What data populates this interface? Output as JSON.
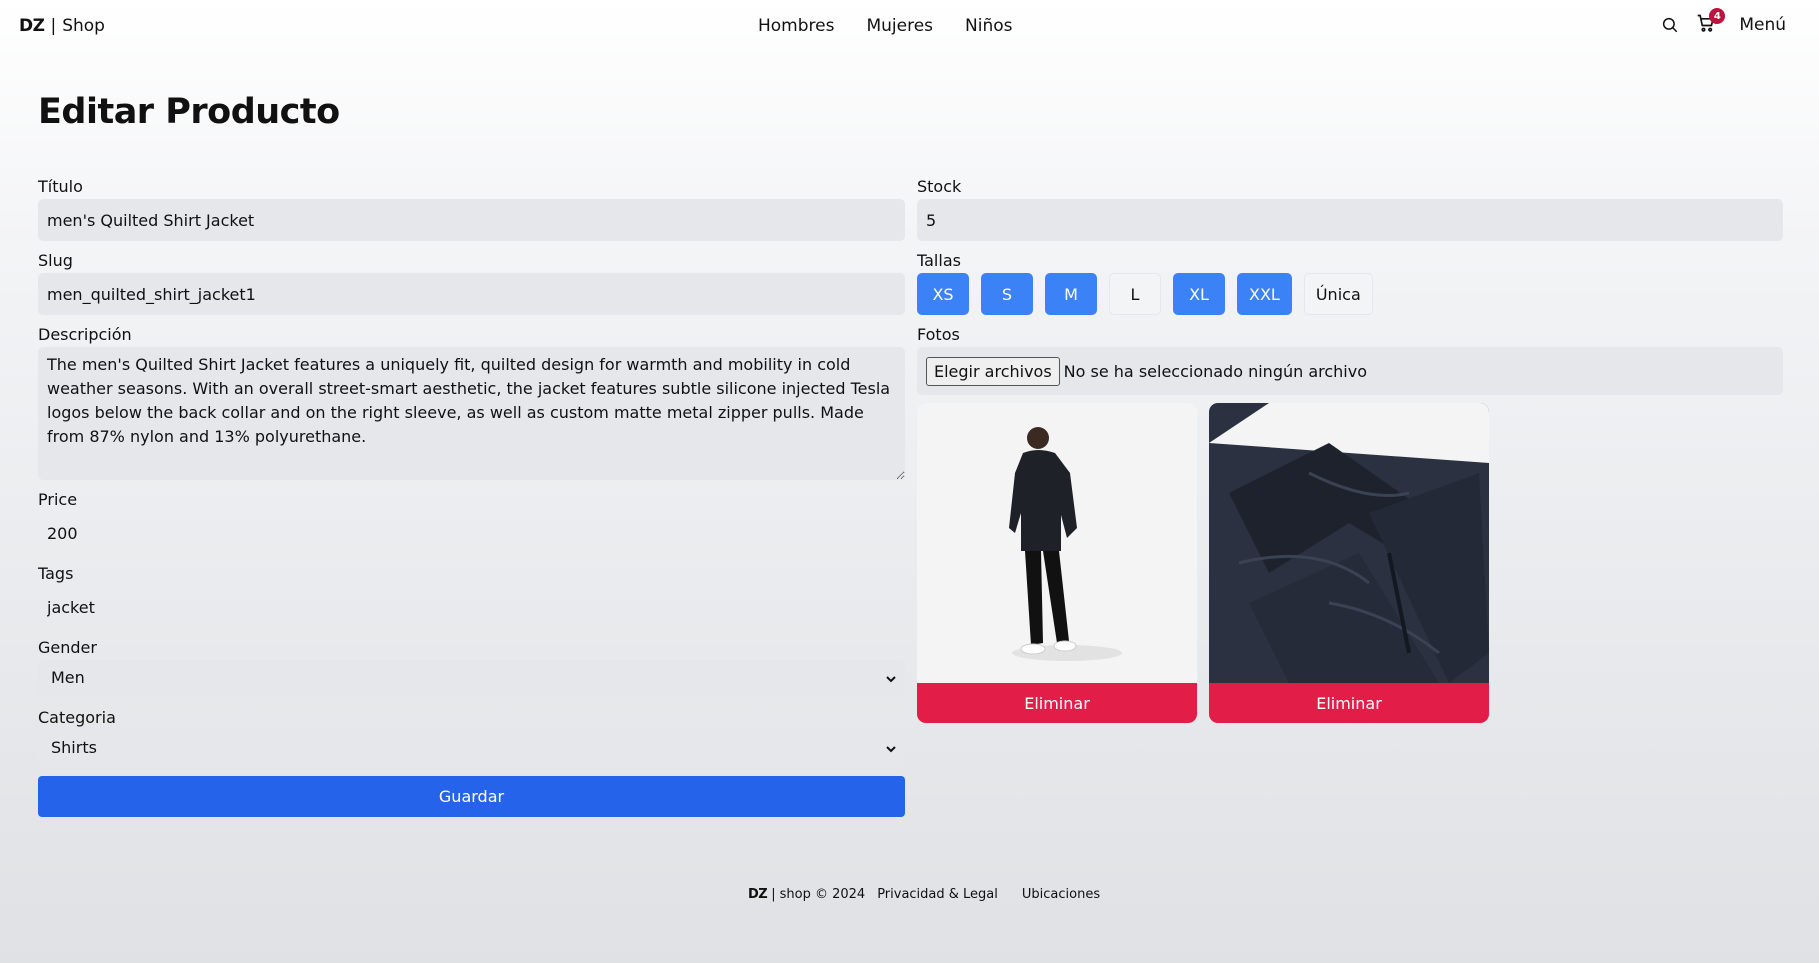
{
  "header": {
    "logo_mark": "DZ",
    "logo_sep": "|",
    "logo_text": "Shop",
    "nav": [
      "Hombres",
      "Mujeres",
      "Niños"
    ],
    "cart_count": "4",
    "menu_label": "Menú"
  },
  "page_title": "Editar Producto",
  "form": {
    "title_label": "Título",
    "title_value": "men's Quilted Shirt Jacket",
    "slug_label": "Slug",
    "slug_value": "men_quilted_shirt_jacket1",
    "description_label": "Descripción",
    "description_value": "The men's Quilted Shirt Jacket features a uniquely fit, quilted design for warmth and mobility in cold weather seasons. With an overall street-smart aesthetic, the jacket features subtle silicone injected Tesla logos below the back collar and on the right sleeve, as well as custom matte metal zipper pulls. Made from 87% nylon and 13% polyurethane.",
    "price_label": "Price",
    "price_value": "200",
    "tags_label": "Tags",
    "tags_value": "jacket",
    "gender_label": "Gender",
    "gender_value": "Men",
    "category_label": "Categoria",
    "category_value": "Shirts",
    "save_label": "Guardar",
    "stock_label": "Stock",
    "stock_value": "5",
    "sizes_label": "Tallas",
    "sizes": [
      {
        "label": "XS",
        "active": true
      },
      {
        "label": "S",
        "active": true
      },
      {
        "label": "M",
        "active": true
      },
      {
        "label": "L",
        "active": false
      },
      {
        "label": "XL",
        "active": true
      },
      {
        "label": "XXL",
        "active": true
      },
      {
        "label": "Única",
        "active": false
      }
    ],
    "photos_label": "Fotos",
    "file_button_label": "Elegir archivos",
    "file_status": "No se ha seleccionado ningún archivo",
    "delete_label": "Eliminar"
  },
  "colors": {
    "primary": "#2563eb",
    "size_active": "#3b82f6",
    "danger": "#e11d48",
    "badge": "#be123c",
    "input_bg": "#e5e7eb"
  },
  "footer": {
    "logo_mark": "DZ",
    "logo_sep": "|",
    "brand": "shop © 2024",
    "links": [
      "Privacidad & Legal",
      "Ubicaciones"
    ]
  }
}
